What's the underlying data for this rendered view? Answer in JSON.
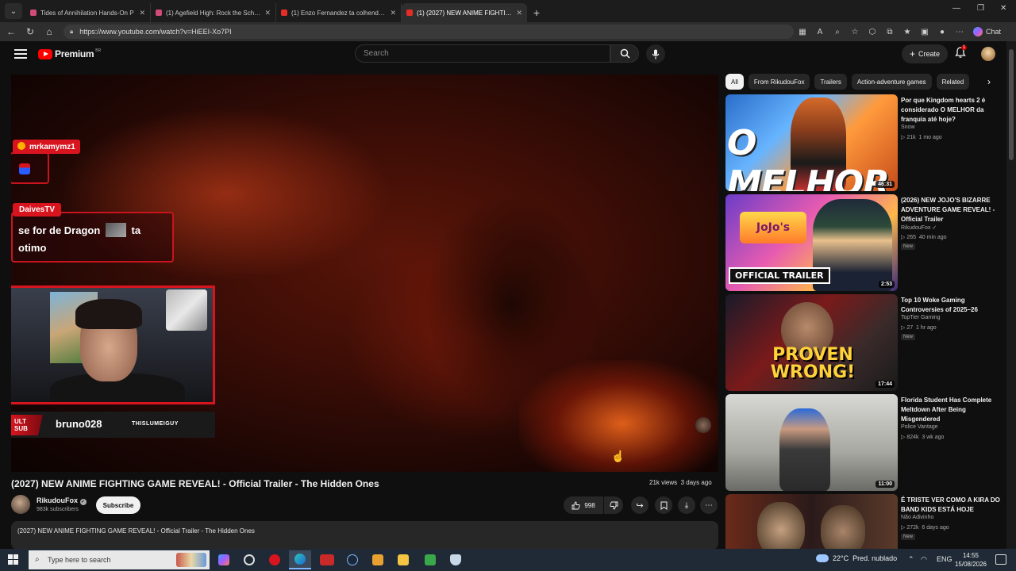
{
  "browser": {
    "tabs": [
      {
        "title": "Tides of Annihilation Hands-On P",
        "active": false
      },
      {
        "title": "(1) Agefield High: Rock the School",
        "active": false
      },
      {
        "title": "(1) Enzo Fernandez ta colhendo tu",
        "active": false
      },
      {
        "title": "(1) (2027) NEW ANIME FIGHTING G",
        "active": true
      }
    ],
    "url": "https://www.youtube.com/watch?v=HiEEI-Xo7PI",
    "chat_label": "Chat"
  },
  "youtube": {
    "logo_text": "Premium",
    "logo_region": "BR",
    "search_placeholder": "Search",
    "create_label": "Create",
    "notification_count": "1"
  },
  "video": {
    "title": "(2027) NEW ANIME FIGHTING GAME REVEAL! - Official Trailer - The Hidden Ones",
    "views": "21k views",
    "age": "3 days ago",
    "channel": "RikudouFox",
    "subscribers": "983k subscribers",
    "subscribe_label": "Subscribe",
    "likes": "998",
    "description": "(2027) NEW ANIME FIGHTING GAME REVEAL! - Official Trailer - The Hidden Ones"
  },
  "overlay": {
    "chat1_user": "mrkamymz1",
    "chat2_user": "DaivesTV",
    "chat2_text_a": "se for de Dragon",
    "chat2_text_b": "ta",
    "chat2_text_c": "otimo",
    "sub_badge": "ULT SUB",
    "sub_name": "bruno028",
    "sub_tag": "THISLUMEIGUY"
  },
  "chips": [
    "All",
    "From RikudouFox",
    "Trailers",
    "Action-adventure games",
    "Related"
  ],
  "recommendations": [
    {
      "title": "Por que Kingdom hearts 2 é considerado O MELHOR da franquia até hoje?",
      "channel": "Snow",
      "views": "21k",
      "age": "1 mo ago",
      "duration": "46:31",
      "is_new": false,
      "thumb_text": "O MELHOR"
    },
    {
      "title": "(2026) NEW JOJO'S BIZARRE ADVENTURE GAME REVEAL! - Official Trailer",
      "channel": "RikudouFox",
      "views": "265",
      "age": "40 min ago",
      "duration": "2:53",
      "is_new": true,
      "new_label": "New",
      "thumb_text": "OFFICIAL TRAILER"
    },
    {
      "title": "Top 10 Woke Gaming Controversies of 2025–26",
      "channel": "TopTier Gaming",
      "views": "27",
      "age": "1 hr ago",
      "duration": "17:44",
      "is_new": true,
      "new_label": "New",
      "thumb_text": "PROVEN WRONG!"
    },
    {
      "title": "Florida Student Has Complete Meltdown After Being Misgendered",
      "channel": "Police Vantage",
      "views": "824k",
      "age": "3 wk ago",
      "duration": "11:00",
      "is_new": false,
      "thumb_text": ""
    },
    {
      "title": "É TRISTE VER COMO A KIRA DO BAND KIDS ESTÁ HOJE",
      "channel": "Não Adivinho",
      "views": "272k",
      "age": "6 days ago",
      "duration": "",
      "is_new": true,
      "new_label": "New",
      "thumb_text": ""
    }
  ],
  "taskbar": {
    "search_placeholder": "Type here to search",
    "weather_temp": "22°C",
    "weather_text": "Pred. nublado",
    "language": "ENG",
    "time": "14:55",
    "date": "15/08/2026"
  }
}
